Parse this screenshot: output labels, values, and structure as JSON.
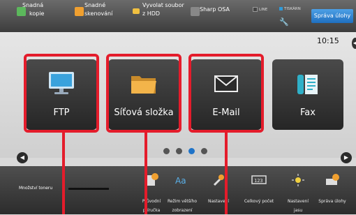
{
  "topbar": {
    "items": [
      {
        "label_line1": "Snadná",
        "label_line2": "kopie"
      },
      {
        "label_line1": "Snadné",
        "label_line2": "skenování"
      },
      {
        "label_line1": "Vyvolat soubor",
        "label_line2": "z HDD"
      },
      {
        "label_line1": "Sharp OSA",
        "label_line2": ""
      }
    ],
    "line_indicator": "LINE",
    "printer_indicator": "TISKÁRN",
    "job_status_button": "Správa úlohy",
    "clock": "10:15"
  },
  "tiles": [
    {
      "label": "FTP",
      "icon": "monitor-icon"
    },
    {
      "label": "Síťová složka",
      "icon": "folder-icon"
    },
    {
      "label": "E-Mail",
      "icon": "envelope-icon"
    },
    {
      "label": "Fax",
      "icon": "fax-icon"
    }
  ],
  "pager": {
    "pages": 4,
    "active": 3
  },
  "bottombar": {
    "toner_label": "Množství toneru",
    "items": [
      {
        "line1": "Průvodní",
        "line2": "příručka",
        "icon": "guide-icon"
      },
      {
        "line1": "Režim většího",
        "line2": "zobrazení",
        "icon": "zoom-icon"
      },
      {
        "line1": "Nastavení",
        "line2": "",
        "icon": "wrench-icon"
      },
      {
        "line1": "Celkový počet",
        "line2": "",
        "icon": "counter-icon"
      },
      {
        "line1": "Nastavení",
        "line2": "jasu",
        "icon": "brightness-icon"
      },
      {
        "line1": "Správa úlohy",
        "line2": "",
        "icon": "job-icon"
      }
    ]
  },
  "colors": {
    "highlight": "#e41c2b",
    "accent_blue": "#1e73c8",
    "tile_bg": "#333333"
  }
}
